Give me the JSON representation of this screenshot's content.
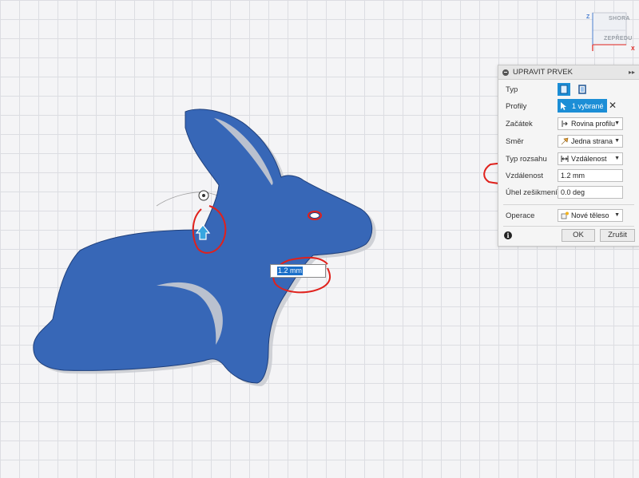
{
  "viewcube": {
    "top_label": "SHORA",
    "front_label": "ZEPŘEDU",
    "axis_z": "Z",
    "axis_x": "X"
  },
  "panel": {
    "title": "UPRAVIT PRVEK",
    "rows": {
      "type": {
        "label": "Typ"
      },
      "profiles": {
        "label": "Profily",
        "value": "1 vybrané"
      },
      "start": {
        "label": "Začátek",
        "value": "Rovina profilu"
      },
      "direction": {
        "label": "Směr",
        "value": "Jedna strana"
      },
      "extent_type": {
        "label": "Typ rozsahu",
        "value": "Vzdálenost"
      },
      "distance": {
        "label": "Vzdálenost",
        "value": "1.2 mm"
      },
      "taper": {
        "label": "Úhel zešikmení",
        "value": "0.0 deg"
      },
      "operation": {
        "label": "Operace",
        "value": "Nové těleso"
      }
    },
    "ok_label": "OK",
    "cancel_label": "Zrušit",
    "info_symbol": "i"
  },
  "canvas_input": {
    "value": "1.2 mm"
  },
  "colors": {
    "body_fill": "#3767b7",
    "annotation": "#e0211c",
    "accent": "#1c8ed6",
    "grid": "#dcdde2"
  }
}
